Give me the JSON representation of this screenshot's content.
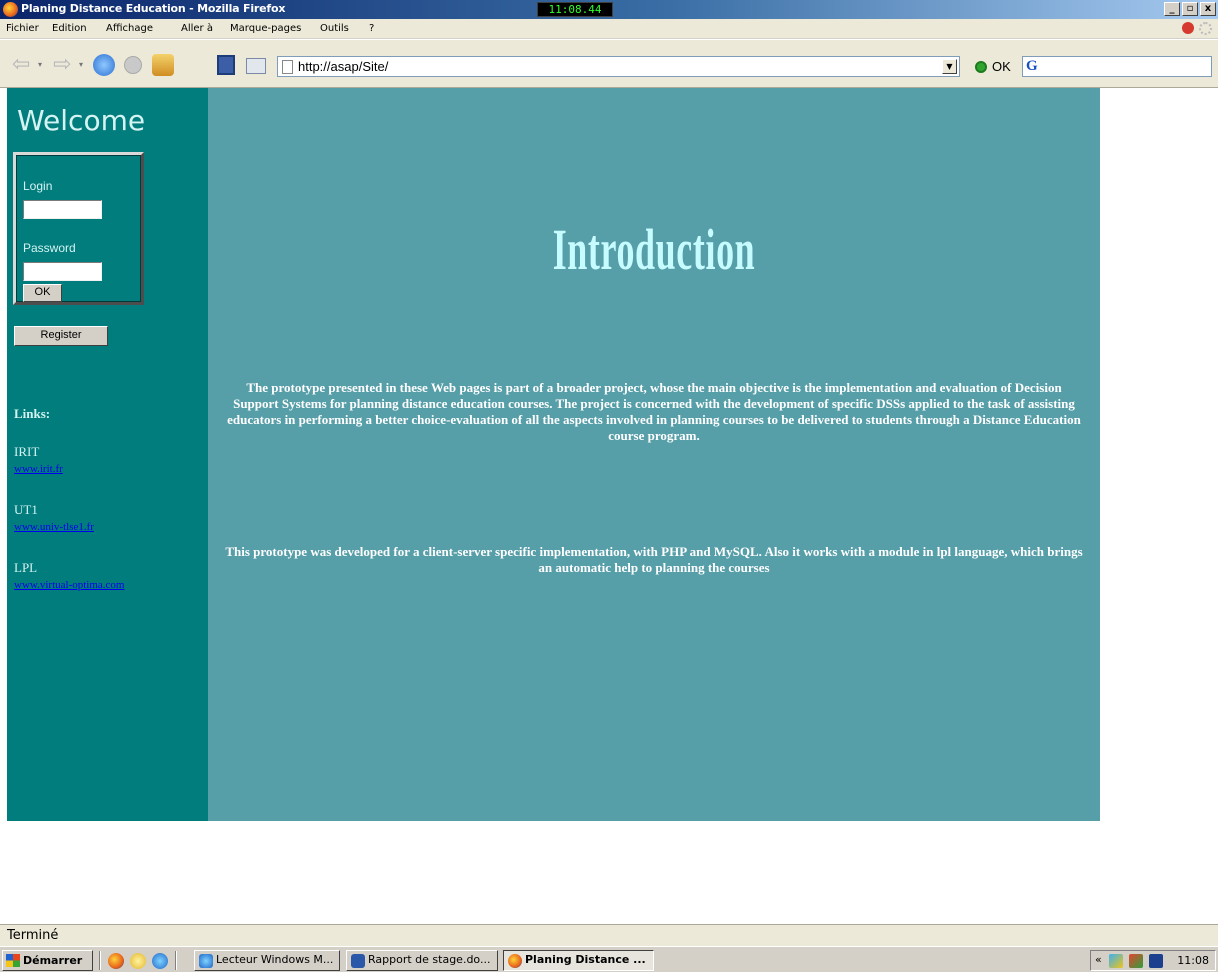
{
  "window": {
    "title": "Planing Distance Education - Mozilla Firefox",
    "clock": "11:08.44",
    "min_label": "_",
    "max_label": "▫",
    "close_label": "x"
  },
  "menu": {
    "items": [
      "Fichier",
      "Edition",
      "Affichage",
      "Aller à",
      "Marque-pages",
      "Outils",
      "?"
    ]
  },
  "navbar": {
    "url": "http://asap/Site/",
    "go_label": "OK",
    "search_engine_icon": "google-icon"
  },
  "sidebar": {
    "welcome": "Welcome",
    "login_label": "Login",
    "password_label": "Password",
    "login_value": "",
    "password_value": "",
    "ok_label": "OK",
    "register_label": "Register",
    "links_heading": "Links:",
    "links": [
      {
        "name": "IRIT",
        "url": "www.irit.fr"
      },
      {
        "name": "UT1",
        "url": "www.univ-tlse1.fr"
      },
      {
        "name": "LPL",
        "url": "www.virtual-optima.com"
      }
    ]
  },
  "main": {
    "heading": "Introduction",
    "paragraph1": "The prototype presented in these Web pages is part of a broader project, whose the main objective is the implementation and evaluation of Decision Support Systems for planning distance education courses. The project is concerned with the development of specific DSSs applied to the task of assisting educators in performing a better choice-evaluation of all the aspects involved in planning courses to be delivered to students through a Distance Education course program.",
    "paragraph2": "This prototype was developed for a client-server specific implementation, with PHP and MySQL. Also it works with a module in lpl language, which brings an automatic help to planning the courses"
  },
  "status": {
    "text": "Terminé"
  },
  "taskbar": {
    "start_label": "Démarrer",
    "tasks": [
      {
        "label": "Lecteur Windows M...",
        "icon": "media-player-icon",
        "active": false
      },
      {
        "label": "Rapport de stage.do...",
        "icon": "word-document-icon",
        "active": false
      },
      {
        "label": "Planing Distance ...",
        "icon": "firefox-icon",
        "active": true
      }
    ],
    "tray_chevron": "«",
    "time": "11:08"
  },
  "colors": {
    "sidebar_bg": "#007d7c",
    "main_bg": "#569ea8",
    "heading": "#c6fbff",
    "link": "#0000ee"
  }
}
